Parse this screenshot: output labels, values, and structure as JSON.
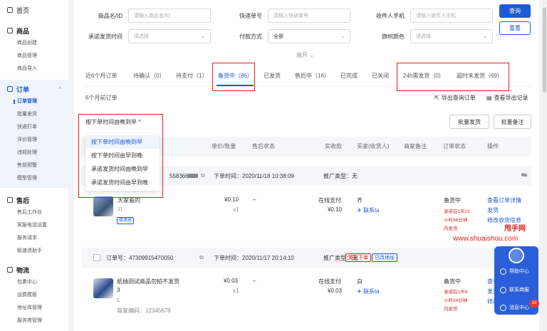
{
  "sidebar": {
    "home": "首页",
    "groups": [
      {
        "title": "商品",
        "items": [
          "商品创建",
          "商品管理",
          "商品导入"
        ]
      },
      {
        "title": "订单",
        "items": [
          "订单管理",
          "批量发货",
          "快递打单",
          "评价管理",
          "违规处理",
          "售前预警",
          "模型管理"
        ]
      },
      {
        "title": "售后",
        "items": [
          "售后工作台",
          "客服电话设置",
          "服务请求",
          "极速退助手"
        ]
      },
      {
        "title": "物流",
        "items": [
          "包裹中心",
          "运费模板",
          "地址库管理",
          "服务商管理"
        ]
      }
    ]
  },
  "filters": {
    "product_label": "商品名/ID",
    "product_placeholder": "请输入商品名/ID",
    "express_label": "快递单号",
    "express_placeholder": "请输入快递单号",
    "phone_label": "收件人手机",
    "phone_placeholder": "请输入收件人手机",
    "ship_time_label": "承诺发货时间",
    "ship_time_placeholder": "请选择",
    "pay_label": "付款方式",
    "pay_value": "全部",
    "flag_label": "旗帜颜色",
    "flag_placeholder": "请选择",
    "search_button": "查询",
    "reset_button": "重置",
    "expand": "展开"
  },
  "tabs": [
    "近6个月订单",
    "待确认（0）",
    "待支付（1）",
    "备货中（86）",
    "已发货",
    "售后中（16）",
    "已完成",
    "已关闭",
    "24h需发货（0）",
    "超时未发货（69）"
  ],
  "subhead": "6个月前订单",
  "export_query": "导出查询订单",
  "export_records": "查看导出记录",
  "sort_label": "按下单时间由晚到早",
  "sort_options": [
    "按下单时间由晚到早",
    "按下单时间由早到晚",
    "承诺发货时间由晚到早",
    "承诺发货时间由早到晚"
  ],
  "batch_ship": "批量发货",
  "batch_note": "批量备注",
  "table_headers": [
    "单价/数量",
    "售后状态",
    "实收款",
    "买家(收货人)",
    "商家备注",
    "订单状态",
    "操作"
  ],
  "orders": [
    {
      "id_partial": "5583667",
      "time": "下单时间：2020/11/18 10:38:09",
      "promo": "推广类型：无",
      "title": "大家看的",
      "spec": "11",
      "tag": "极速退",
      "price": "¥0.10",
      "qty": "x1",
      "aftersale": "–",
      "pay_method": "在线支付",
      "paid": "¥0.10",
      "buyer": "齐",
      "contact": "联系ta",
      "status": "备货中",
      "deadline": [
        "承诺在1天22",
        "小时48分钟",
        "内发货"
      ],
      "actions": [
        "查看订单详情",
        "发货",
        "修改收货信息"
      ]
    },
    {
      "id_label": "订单号：47309915470050",
      "time": "下单时间：2020/11/17 20:14:10",
      "promo": "推广类型：无",
      "tag_red": "重复下单",
      "tag_blue": "已改地址",
      "title": "纸抽测试商品勿拍不发货",
      "title2": "3",
      "spec": "L",
      "code": "商家编码：12345678",
      "price": "¥0.03",
      "qty": "x1",
      "aftersale": "–",
      "pay_method": "在线支付",
      "paid": "¥0.03",
      "buyer": "白",
      "contact": "联系ta",
      "status": "备货中",
      "deadline": [
        "承诺在1天8",
        "小时24分钟",
        "内发货"
      ],
      "actions": [
        "查看",
        "发货",
        "修改"
      ]
    }
  ],
  "watermark": {
    "brand": "甩手网",
    "url": "www.shuaishou.com"
  },
  "float_panel": {
    "help": "帮助中心",
    "service": "联系商服",
    "message": "消息中心",
    "count": "16"
  },
  "colors": {
    "primary": "#1d5bd6",
    "highlight_red": "#e02020"
  }
}
